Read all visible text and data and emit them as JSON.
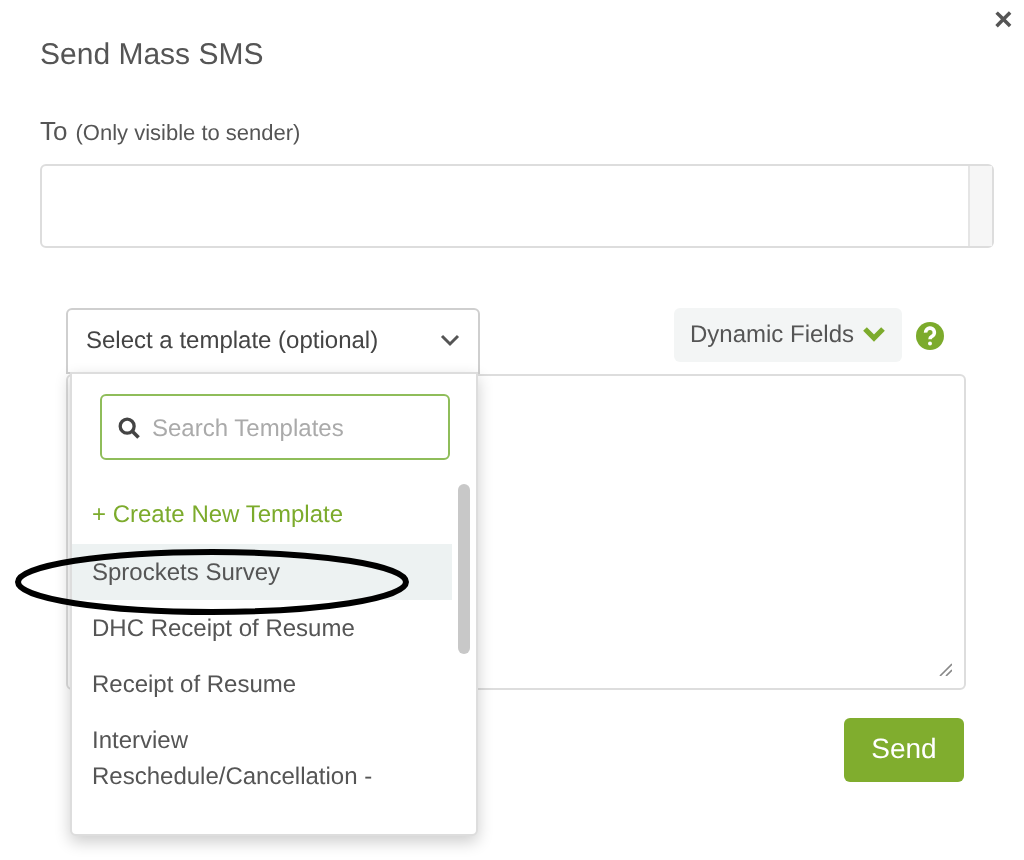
{
  "dialog": {
    "title": "Send Mass SMS",
    "close": "×"
  },
  "to": {
    "label": "To",
    "hint": "(Only visible to sender)"
  },
  "template_select": {
    "label": "Select a template (optional)",
    "expanded": true,
    "search": {
      "placeholder": "Search Templates"
    },
    "create": "+ Create New Template",
    "items": [
      {
        "label": "Sprockets Survey",
        "selected": true
      },
      {
        "label": "DHC Receipt of Resume",
        "selected": false
      },
      {
        "label": "Receipt of Resume",
        "selected": false
      },
      {
        "label": "Interview Reschedule/Cancellation -",
        "selected": false
      }
    ]
  },
  "dynamic_fields": {
    "label": "Dynamic Fields"
  },
  "send_button": "Send"
}
